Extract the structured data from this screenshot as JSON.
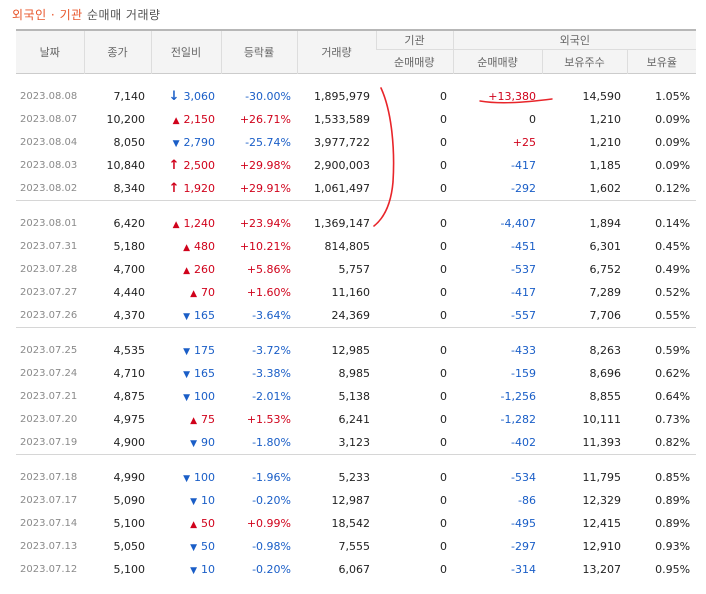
{
  "title": {
    "part1": "외국인 · 기관",
    "part2": "순매매 거래량"
  },
  "headers": {
    "date": "날짜",
    "close": "종가",
    "change": "전일비",
    "rate": "등락률",
    "volume": "거래량",
    "inst_group": "기관",
    "foreign_group": "외국인",
    "inst_net": "순매매량",
    "foreign_net": "순매매량",
    "holdings": "보유주수",
    "ratio": "보유율"
  },
  "rows": [
    {
      "date": "2023.08.08",
      "close": "7,140",
      "dir": "down-big",
      "change": "3,060",
      "rate": "-30.00%",
      "volume": "1,895,979",
      "inst": "0",
      "foreign": "+13,380",
      "holdings": "14,590",
      "ratio": "1.05%"
    },
    {
      "date": "2023.08.07",
      "close": "10,200",
      "dir": "up",
      "change": "2,150",
      "rate": "+26.71%",
      "volume": "1,533,589",
      "inst": "0",
      "foreign": "0",
      "holdings": "1,210",
      "ratio": "0.09%"
    },
    {
      "date": "2023.08.04",
      "close": "8,050",
      "dir": "down",
      "change": "2,790",
      "rate": "-25.74%",
      "volume": "3,977,722",
      "inst": "0",
      "foreign": "+25",
      "holdings": "1,210",
      "ratio": "0.09%"
    },
    {
      "date": "2023.08.03",
      "close": "10,840",
      "dir": "up-big",
      "change": "2,500",
      "rate": "+29.98%",
      "volume": "2,900,003",
      "inst": "0",
      "foreign": "-417",
      "holdings": "1,185",
      "ratio": "0.09%"
    },
    {
      "date": "2023.08.02",
      "close": "8,340",
      "dir": "up-big",
      "change": "1,920",
      "rate": "+29.91%",
      "volume": "1,061,497",
      "inst": "0",
      "foreign": "-292",
      "holdings": "1,602",
      "ratio": "0.12%"
    },
    {
      "date": "2023.08.01",
      "close": "6,420",
      "dir": "up",
      "change": "1,240",
      "rate": "+23.94%",
      "volume": "1,369,147",
      "inst": "0",
      "foreign": "-4,407",
      "holdings": "1,894",
      "ratio": "0.14%"
    },
    {
      "date": "2023.07.31",
      "close": "5,180",
      "dir": "up",
      "change": "480",
      "rate": "+10.21%",
      "volume": "814,805",
      "inst": "0",
      "foreign": "-451",
      "holdings": "6,301",
      "ratio": "0.45%"
    },
    {
      "date": "2023.07.28",
      "close": "4,700",
      "dir": "up",
      "change": "260",
      "rate": "+5.86%",
      "volume": "5,757",
      "inst": "0",
      "foreign": "-537",
      "holdings": "6,752",
      "ratio": "0.49%"
    },
    {
      "date": "2023.07.27",
      "close": "4,440",
      "dir": "up",
      "change": "70",
      "rate": "+1.60%",
      "volume": "11,160",
      "inst": "0",
      "foreign": "-417",
      "holdings": "7,289",
      "ratio": "0.52%"
    },
    {
      "date": "2023.07.26",
      "close": "4,370",
      "dir": "down",
      "change": "165",
      "rate": "-3.64%",
      "volume": "24,369",
      "inst": "0",
      "foreign": "-557",
      "holdings": "7,706",
      "ratio": "0.55%"
    },
    {
      "date": "2023.07.25",
      "close": "4,535",
      "dir": "down",
      "change": "175",
      "rate": "-3.72%",
      "volume": "12,985",
      "inst": "0",
      "foreign": "-433",
      "holdings": "8,263",
      "ratio": "0.59%"
    },
    {
      "date": "2023.07.24",
      "close": "4,710",
      "dir": "down",
      "change": "165",
      "rate": "-3.38%",
      "volume": "8,985",
      "inst": "0",
      "foreign": "-159",
      "holdings": "8,696",
      "ratio": "0.62%"
    },
    {
      "date": "2023.07.21",
      "close": "4,875",
      "dir": "down",
      "change": "100",
      "rate": "-2.01%",
      "volume": "5,138",
      "inst": "0",
      "foreign": "-1,256",
      "holdings": "8,855",
      "ratio": "0.64%"
    },
    {
      "date": "2023.07.20",
      "close": "4,975",
      "dir": "up",
      "change": "75",
      "rate": "+1.53%",
      "volume": "6,241",
      "inst": "0",
      "foreign": "-1,282",
      "holdings": "10,111",
      "ratio": "0.73%"
    },
    {
      "date": "2023.07.19",
      "close": "4,900",
      "dir": "down",
      "change": "90",
      "rate": "-1.80%",
      "volume": "3,123",
      "inst": "0",
      "foreign": "-402",
      "holdings": "11,393",
      "ratio": "0.82%"
    },
    {
      "date": "2023.07.18",
      "close": "4,990",
      "dir": "down",
      "change": "100",
      "rate": "-1.96%",
      "volume": "5,233",
      "inst": "0",
      "foreign": "-534",
      "holdings": "11,795",
      "ratio": "0.85%"
    },
    {
      "date": "2023.07.17",
      "close": "5,090",
      "dir": "down",
      "change": "10",
      "rate": "-0.20%",
      "volume": "12,987",
      "inst": "0",
      "foreign": "-86",
      "holdings": "12,329",
      "ratio": "0.89%"
    },
    {
      "date": "2023.07.14",
      "close": "5,100",
      "dir": "up",
      "change": "50",
      "rate": "+0.99%",
      "volume": "18,542",
      "inst": "0",
      "foreign": "-495",
      "holdings": "12,415",
      "ratio": "0.89%"
    },
    {
      "date": "2023.07.13",
      "close": "5,050",
      "dir": "down",
      "change": "50",
      "rate": "-0.98%",
      "volume": "7,555",
      "inst": "0",
      "foreign": "-297",
      "holdings": "12,910",
      "ratio": "0.93%"
    },
    {
      "date": "2023.07.12",
      "close": "5,100",
      "dir": "down",
      "change": "10",
      "rate": "-0.20%",
      "volume": "6,067",
      "inst": "0",
      "foreign": "-314",
      "holdings": "13,207",
      "ratio": "0.95%"
    }
  ],
  "group_size": 5,
  "colors": {
    "up": "#d0021b",
    "down": "#1a5ec7",
    "annotation": "#e8252a",
    "title_accent": "#e8552a"
  },
  "icons": {
    "up": "triangle-up-icon",
    "down": "triangle-down-icon",
    "up-big": "bold-up-arrow-icon",
    "down-big": "bold-down-arrow-icon"
  }
}
